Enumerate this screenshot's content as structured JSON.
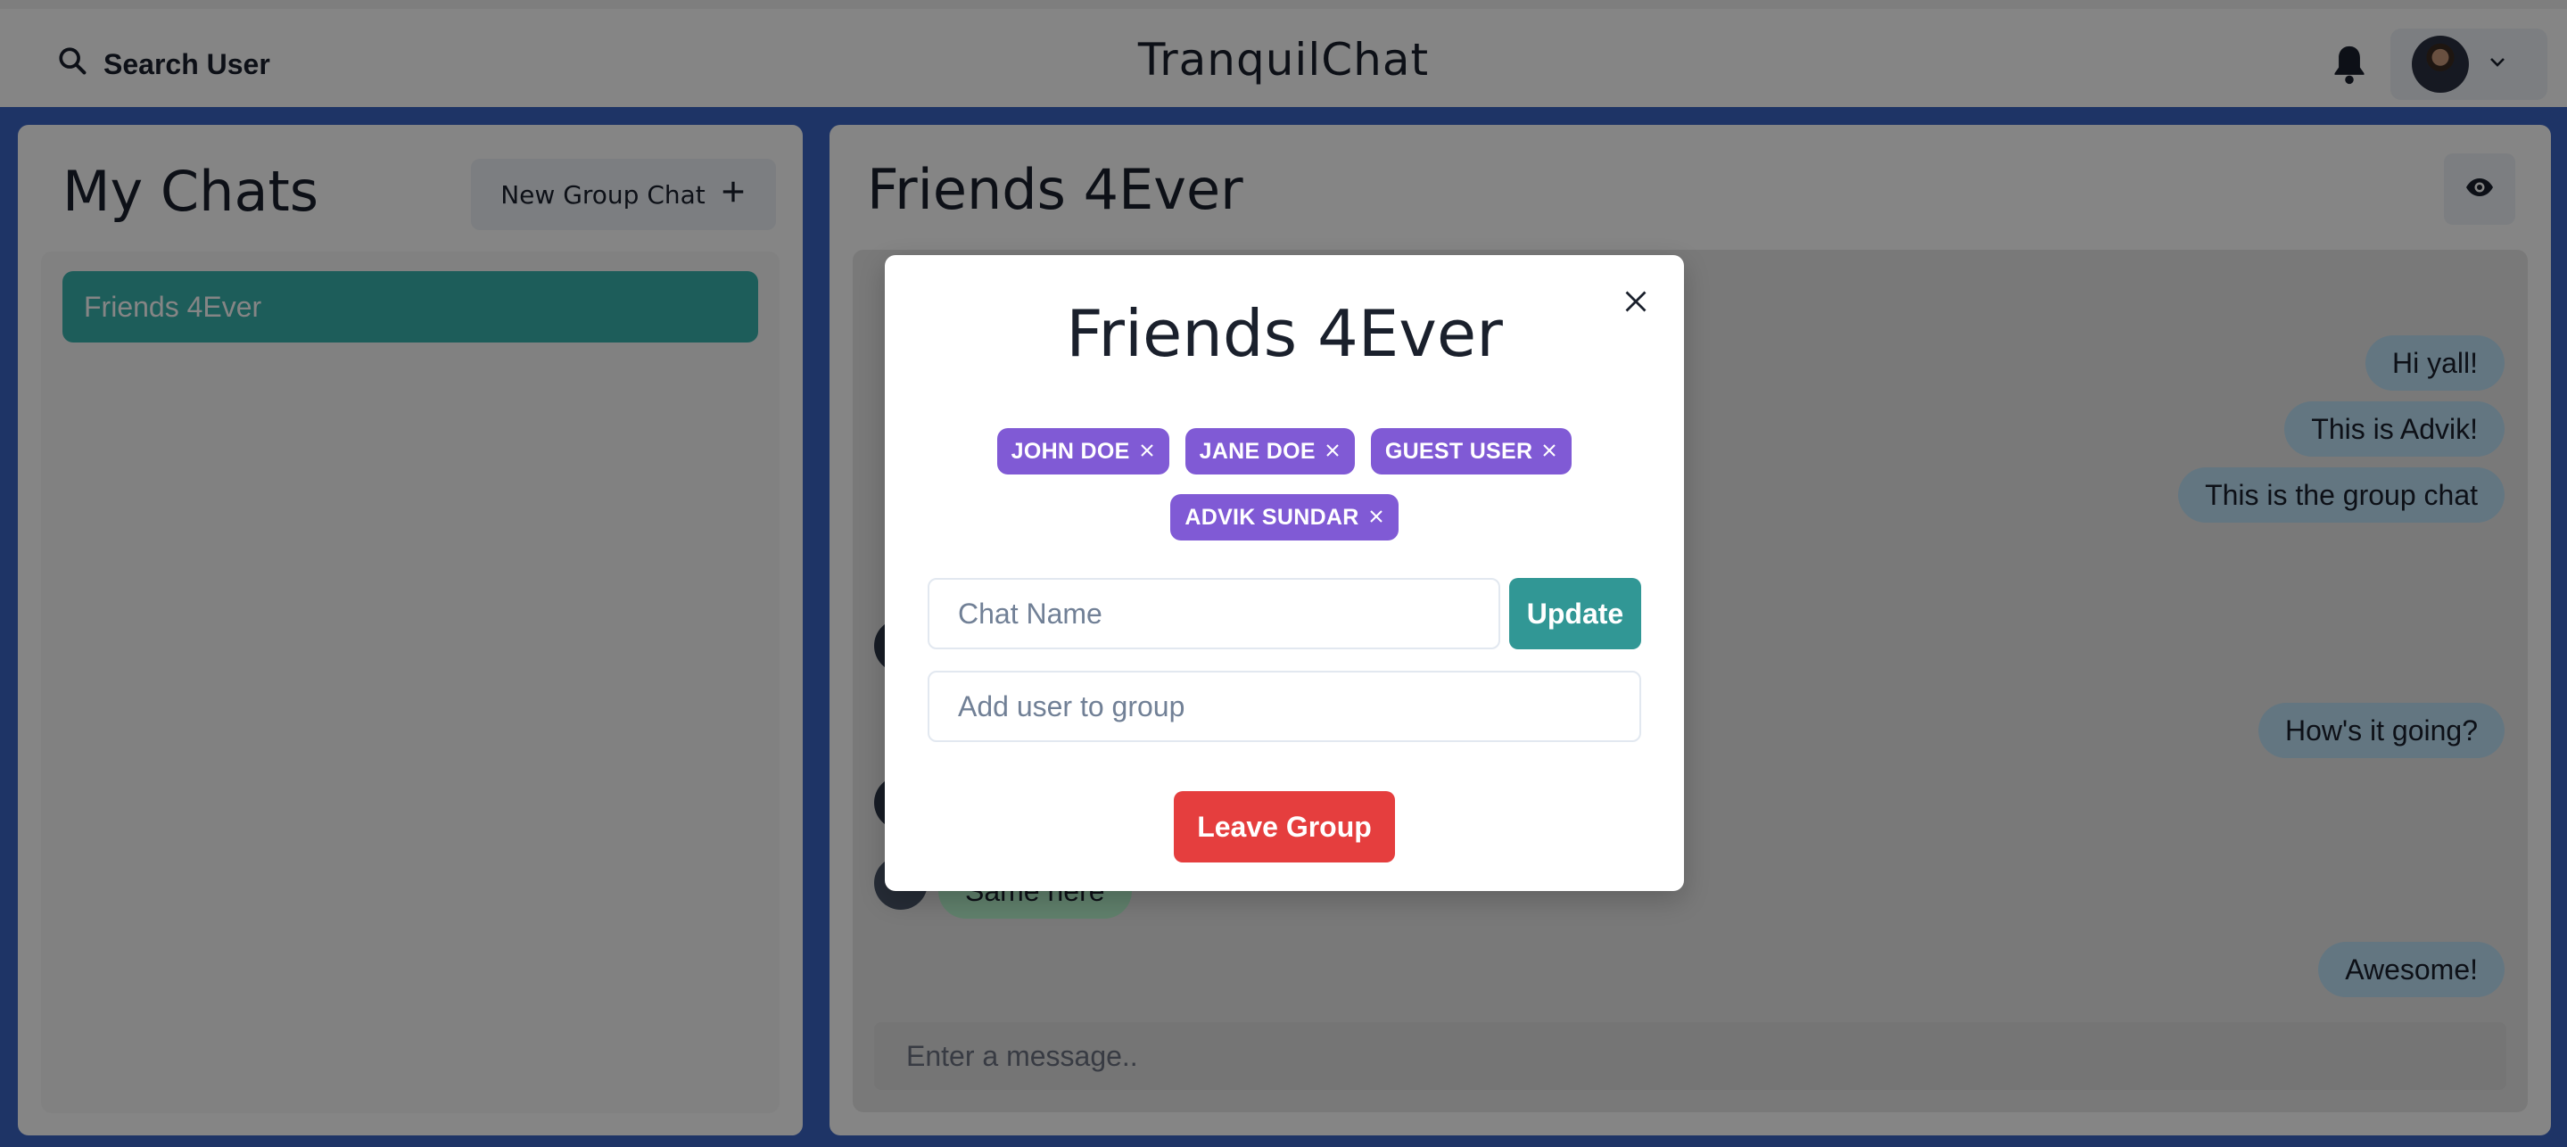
{
  "header": {
    "search_label": "Search User",
    "app_title": "TranquilChat"
  },
  "sidebar": {
    "title": "My Chats",
    "new_group_label": "New Group Chat",
    "chats": [
      {
        "name": "Friends 4Ever",
        "selected": true
      }
    ]
  },
  "chat": {
    "title": "Friends 4Ever",
    "messages": [
      {
        "text": "Hi yall!",
        "sender": "self"
      },
      {
        "text": "This is Advik!",
        "sender": "self"
      },
      {
        "text": "This is the group chat",
        "sender": "self"
      },
      {
        "text": "How's it going?",
        "sender": "self"
      },
      {
        "text": "Same here",
        "sender": "other"
      },
      {
        "text": "Awesome!",
        "sender": "self"
      }
    ],
    "input_placeholder": "Enter a message.."
  },
  "modal": {
    "title": "Friends 4Ever",
    "members": [
      "JOHN DOE",
      "JANE DOE",
      "GUEST USER",
      "ADVIK SUNDAR"
    ],
    "chat_name_placeholder": "Chat Name",
    "update_label": "Update",
    "add_user_placeholder": "Add user to group",
    "leave_label": "Leave Group"
  },
  "colors": {
    "background": "#3b65c4",
    "selected_chat": "#38b2ac",
    "badge": "#805ad5",
    "update": "#319795",
    "leave": "#e53e3e",
    "own_bubble": "#bee3f8",
    "other_bubble": "#b9f5d0"
  }
}
